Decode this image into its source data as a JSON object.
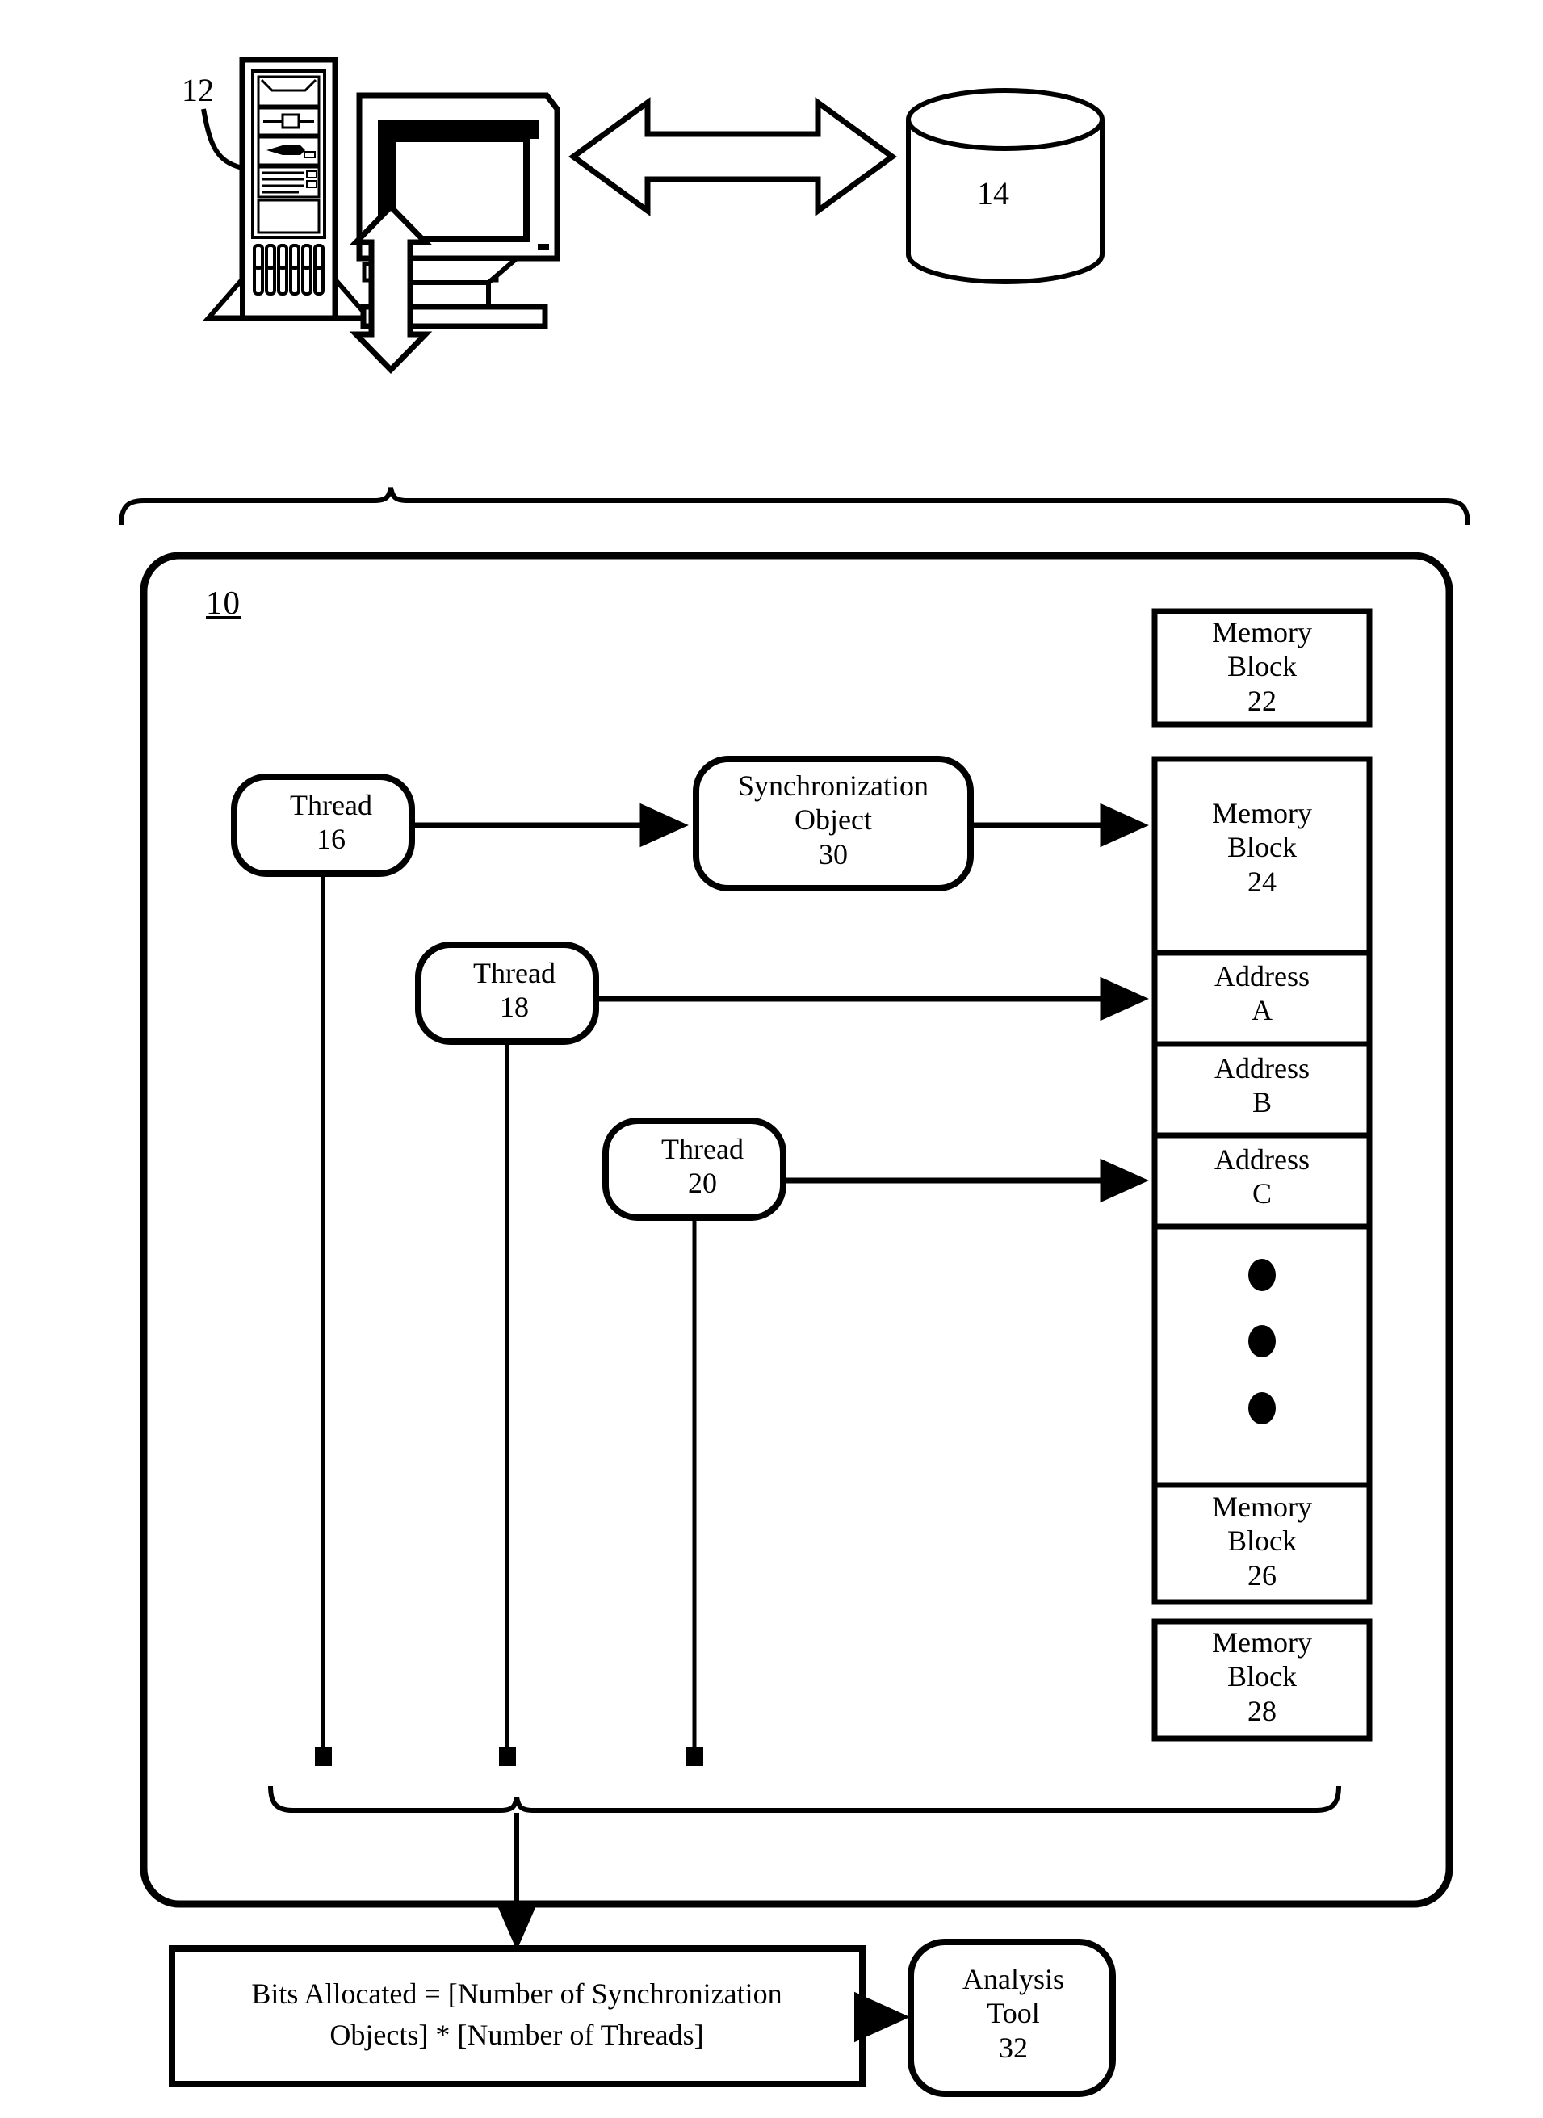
{
  "figure": {
    "type": "patent-diagram",
    "title": "Thread synchronization and memory block allocation diagram"
  },
  "refs": {
    "computer_system": "12",
    "database": "14",
    "runtime_environment": "10"
  },
  "nodes": {
    "thread16": {
      "name": "Thread",
      "ref": "16",
      "label": "Thread\n16"
    },
    "thread18": {
      "name": "Thread",
      "ref": "18",
      "label": "Thread\n18"
    },
    "thread20": {
      "name": "Thread",
      "ref": "20",
      "label": "Thread\n20"
    },
    "sync_object": {
      "name": "Synchronization Object",
      "ref": "30",
      "label": "Synchronization\nObject\n30"
    },
    "analysis_tool": {
      "name": "Analysis Tool",
      "ref": "32",
      "label": "Analysis\nTool\n32"
    }
  },
  "memory": {
    "block22": {
      "label": "Memory\nBlock\n22",
      "ref": "22"
    },
    "block24": {
      "label": "Memory\nBlock\n24",
      "ref": "24"
    },
    "address_a": {
      "label": "Address\nA",
      "ref": "A"
    },
    "address_b": {
      "label": "Address\nB",
      "ref": "B"
    },
    "address_c": {
      "label": "Address\nC",
      "ref": "C"
    },
    "ellipsis": {
      "label": "•••",
      "dots": 3
    },
    "block26": {
      "label": "Memory\nBlock\n26",
      "ref": "26"
    },
    "block28": {
      "label": "Memory\nBlock\n28",
      "ref": "28"
    }
  },
  "formula": {
    "text": "Bits Allocated = [Number of Synchronization\nObjects] * [Number of Threads]"
  },
  "icons": {
    "computer_tower": "computer-tower-icon",
    "crt_monitor": "crt-monitor-icon",
    "database_cylinder": "database-cylinder-icon",
    "double_arrow_horizontal": "double-arrow-horizontal-icon",
    "double_arrow_vertical": "double-arrow-vertical-icon",
    "brace_top": "curly-brace-icon",
    "brace_bottom": "curly-brace-icon"
  },
  "colors": {
    "stroke": "#000000",
    "fill": "#ffffff"
  }
}
